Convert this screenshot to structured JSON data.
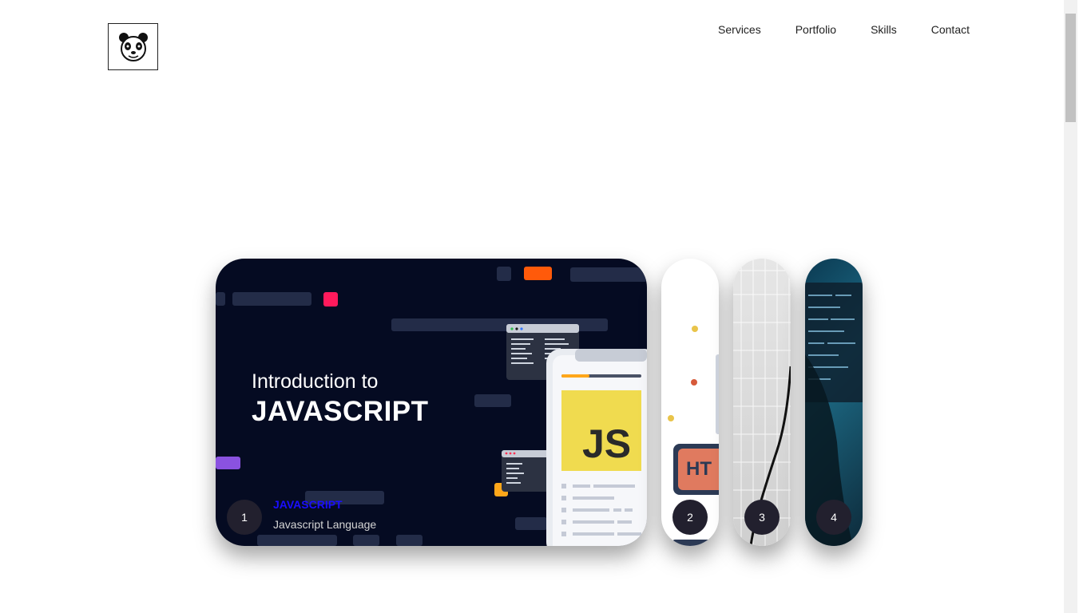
{
  "nav": {
    "items": [
      "Services",
      "Portfolio",
      "Skills",
      "Contact"
    ]
  },
  "slider": {
    "active": {
      "number": "1",
      "title": "JAVASCRIPT",
      "subtitle": "Javascript Language",
      "image_text_line1": "Introduction to",
      "image_text_line2": "JAVASCRIPT",
      "badge": "JS"
    },
    "others": [
      {
        "number": "2",
        "partial_text": "HT"
      },
      {
        "number": "3"
      },
      {
        "number": "4"
      }
    ]
  }
}
